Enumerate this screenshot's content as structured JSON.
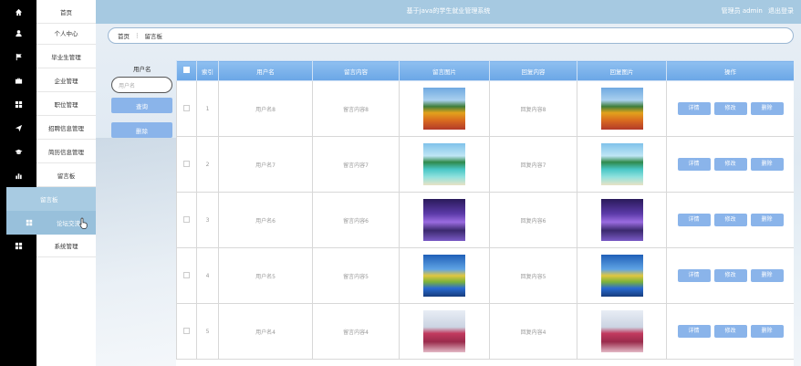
{
  "header": {
    "title": "基于java的学生就业管理系统",
    "user_label": "管理员 admin",
    "logout_label": "退出登录"
  },
  "sidebar": {
    "items": [
      {
        "label": "首页",
        "icon": "home-icon"
      },
      {
        "label": "个人中心",
        "icon": "user-icon"
      },
      {
        "label": "毕业生管理",
        "icon": "flag-icon"
      },
      {
        "label": "企业管理",
        "icon": "briefcase-icon"
      },
      {
        "label": "职位管理",
        "icon": "grid-icon"
      },
      {
        "label": "招聘信息管理",
        "icon": "send-icon"
      },
      {
        "label": "简历信息管理",
        "icon": "graduation-icon"
      },
      {
        "label": "留言板",
        "icon": "chart-icon"
      },
      {
        "label": "系统管理",
        "icon": "grid-icon"
      }
    ],
    "sub_items": [
      {
        "label": "留言板"
      },
      {
        "label": "论坛交流"
      }
    ]
  },
  "breadcrumb": {
    "home": "首页",
    "separator": "⋮",
    "current": "留言板"
  },
  "search": {
    "label": "用户名",
    "placeholder": "用户名",
    "query_button": "查询",
    "delete_button": "删除"
  },
  "table": {
    "columns": [
      "索引",
      "用户名",
      "留言内容",
      "留言图片",
      "回复内容",
      "回复图片",
      "操作"
    ],
    "rows": [
      {
        "index": "1",
        "username": "用户名8",
        "message": "留言内容8",
        "image": "flowers",
        "reply": "回复内容8",
        "reply_image": "flowers"
      },
      {
        "index": "2",
        "username": "用户名7",
        "message": "留言内容7",
        "image": "beach",
        "reply": "回复内容7",
        "reply_image": "beach"
      },
      {
        "index": "3",
        "username": "用户名6",
        "message": "留言内容6",
        "image": "purple",
        "reply": "回复内容6",
        "reply_image": "purple"
      },
      {
        "index": "4",
        "username": "用户名5",
        "message": "留言内容5",
        "image": "tree",
        "reply": "回复内容5",
        "reply_image": "tree"
      },
      {
        "index": "5",
        "username": "用户名4",
        "message": "留言内容4",
        "image": "pink",
        "reply": "回复内容4",
        "reply_image": "pink"
      }
    ],
    "actions": {
      "detail": "详情",
      "edit": "修改",
      "delete": "删除"
    }
  },
  "colors": {
    "accent": "#8ab4ea",
    "header": "#a6c9e1",
    "sidebar_active": "#98c0db"
  }
}
